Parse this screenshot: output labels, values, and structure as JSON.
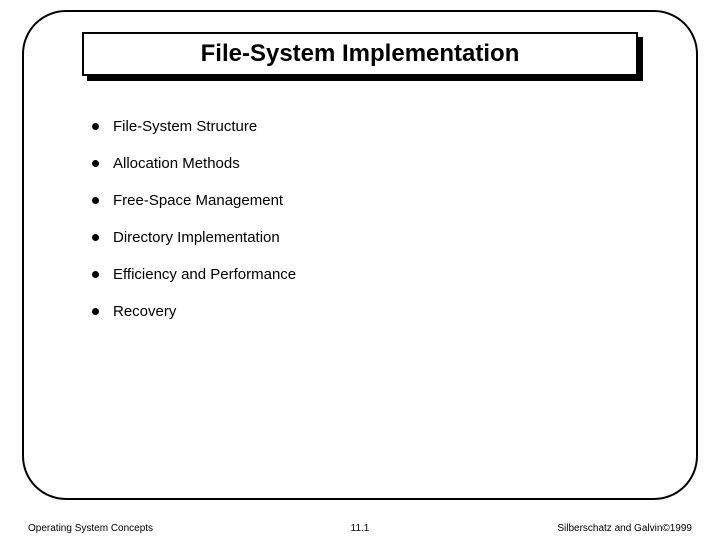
{
  "title": "File-System Implementation",
  "bullets": [
    "File-System Structure",
    "Allocation Methods",
    "Free-Space Management",
    "Directory Implementation",
    "Efficiency and Performance",
    "Recovery"
  ],
  "footer": {
    "left": "Operating System Concepts",
    "center": "11.1",
    "right": "Silberschatz and Galvin©1999"
  }
}
